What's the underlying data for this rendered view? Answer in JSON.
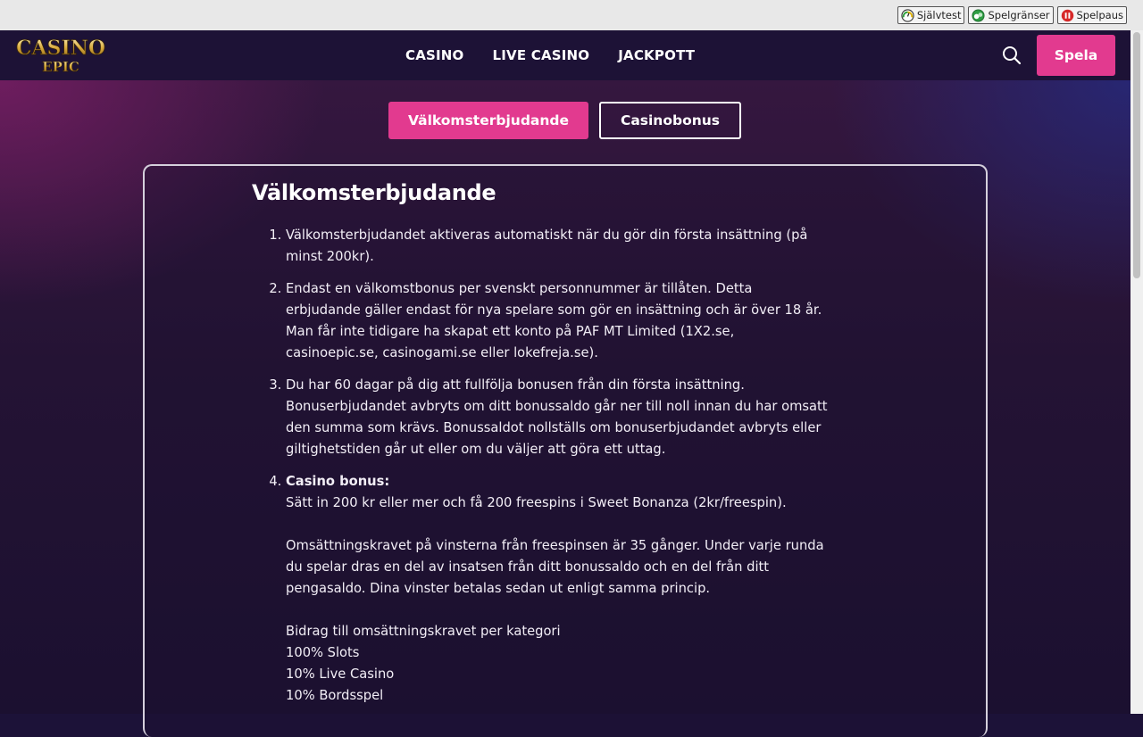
{
  "regbar": {
    "buttons": [
      {
        "label": "Självtest",
        "icon": "speedometer-icon"
      },
      {
        "label": "Spelgränser",
        "icon": "limits-icon"
      },
      {
        "label": "Spelpaus",
        "icon": "pause-icon"
      }
    ]
  },
  "header": {
    "logo_top": "CASINO",
    "logo_bottom": "EPIC",
    "nav": [
      "CASINO",
      "LIVE CASINO",
      "JACKPOTT"
    ],
    "cta": "Spela"
  },
  "tabs": [
    "Välkomsterbjudande",
    "Casinobonus"
  ],
  "content": {
    "title": "Välkomsterbjudande",
    "items": [
      "Välkomsterbjudandet aktiveras automatiskt när du gör din första insättning (på minst 200kr).",
      "Endast en välkomstbonus per svenskt personnummer är tillåten. Detta erbjudande gäller endast för nya spelare som gör en insättning och är över 18 år. Man får inte tidigare ha skapat ett konto på PAF MT Limited (1X2.se, casinoepic.se, casinogami.se eller lokefreja.se).",
      "Du har 60 dagar på dig att fullfölja bonusen från din första insättning. Bonuserbjudandet avbryts om ditt bonussaldo går ner till noll innan du har omsatt den summa som krävs. Bonussaldot nollställs om bonuserbjudandet avbryts eller giltighetstiden går ut eller om du väljer att göra ett uttag."
    ],
    "item4": {
      "heading": "Casino bonus:",
      "line1": "Sätt in 200 kr eller mer och få 200 freespins i Sweet Bonanza (2kr/freespin).",
      "para2": "Omsättningskravet på vinsterna från freespinsen är 35 gånger. Under varje runda du spelar dras en del av insatsen från ditt bonussaldo och en del från ditt pengasaldo. Dina vinster betalas sedan ut enligt samma princip.",
      "contrib_heading": "Bidrag till omsättningskravet per kategori",
      "contrib": [
        "100% Slots",
        "10% Live Casino",
        "10% Bordsspel"
      ]
    }
  },
  "colors": {
    "accent": "#e23a8f",
    "header_bg": "#1d1236"
  }
}
